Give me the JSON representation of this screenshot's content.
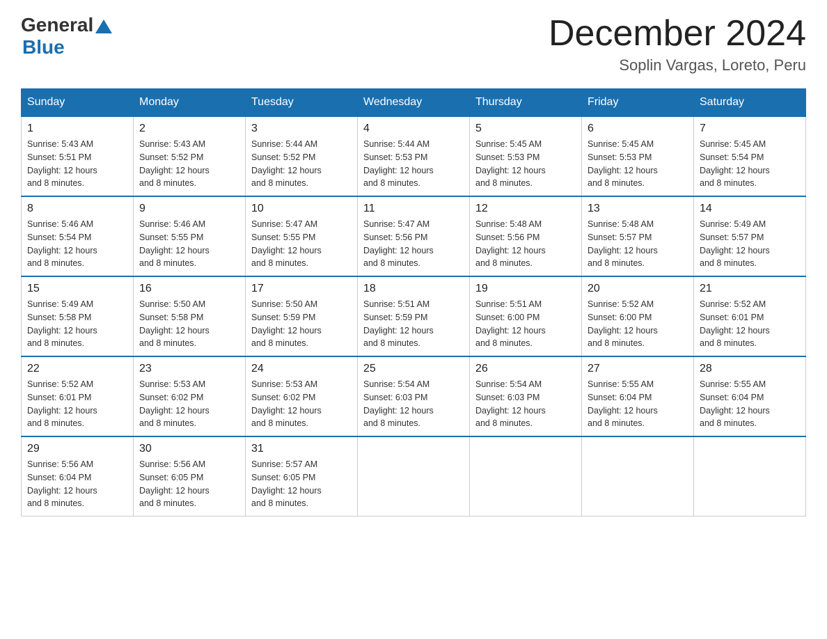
{
  "logo": {
    "general": "General",
    "blue": "Blue"
  },
  "title": {
    "month": "December 2024",
    "location": "Soplin Vargas, Loreto, Peru"
  },
  "headers": [
    "Sunday",
    "Monday",
    "Tuesday",
    "Wednesday",
    "Thursday",
    "Friday",
    "Saturday"
  ],
  "weeks": [
    [
      {
        "day": "1",
        "sunrise": "5:43 AM",
        "sunset": "5:51 PM",
        "daylight": "12 hours and 8 minutes."
      },
      {
        "day": "2",
        "sunrise": "5:43 AM",
        "sunset": "5:52 PM",
        "daylight": "12 hours and 8 minutes."
      },
      {
        "day": "3",
        "sunrise": "5:44 AM",
        "sunset": "5:52 PM",
        "daylight": "12 hours and 8 minutes."
      },
      {
        "day": "4",
        "sunrise": "5:44 AM",
        "sunset": "5:53 PM",
        "daylight": "12 hours and 8 minutes."
      },
      {
        "day": "5",
        "sunrise": "5:45 AM",
        "sunset": "5:53 PM",
        "daylight": "12 hours and 8 minutes."
      },
      {
        "day": "6",
        "sunrise": "5:45 AM",
        "sunset": "5:53 PM",
        "daylight": "12 hours and 8 minutes."
      },
      {
        "day": "7",
        "sunrise": "5:45 AM",
        "sunset": "5:54 PM",
        "daylight": "12 hours and 8 minutes."
      }
    ],
    [
      {
        "day": "8",
        "sunrise": "5:46 AM",
        "sunset": "5:54 PM",
        "daylight": "12 hours and 8 minutes."
      },
      {
        "day": "9",
        "sunrise": "5:46 AM",
        "sunset": "5:55 PM",
        "daylight": "12 hours and 8 minutes."
      },
      {
        "day": "10",
        "sunrise": "5:47 AM",
        "sunset": "5:55 PM",
        "daylight": "12 hours and 8 minutes."
      },
      {
        "day": "11",
        "sunrise": "5:47 AM",
        "sunset": "5:56 PM",
        "daylight": "12 hours and 8 minutes."
      },
      {
        "day": "12",
        "sunrise": "5:48 AM",
        "sunset": "5:56 PM",
        "daylight": "12 hours and 8 minutes."
      },
      {
        "day": "13",
        "sunrise": "5:48 AM",
        "sunset": "5:57 PM",
        "daylight": "12 hours and 8 minutes."
      },
      {
        "day": "14",
        "sunrise": "5:49 AM",
        "sunset": "5:57 PM",
        "daylight": "12 hours and 8 minutes."
      }
    ],
    [
      {
        "day": "15",
        "sunrise": "5:49 AM",
        "sunset": "5:58 PM",
        "daylight": "12 hours and 8 minutes."
      },
      {
        "day": "16",
        "sunrise": "5:50 AM",
        "sunset": "5:58 PM",
        "daylight": "12 hours and 8 minutes."
      },
      {
        "day": "17",
        "sunrise": "5:50 AM",
        "sunset": "5:59 PM",
        "daylight": "12 hours and 8 minutes."
      },
      {
        "day": "18",
        "sunrise": "5:51 AM",
        "sunset": "5:59 PM",
        "daylight": "12 hours and 8 minutes."
      },
      {
        "day": "19",
        "sunrise": "5:51 AM",
        "sunset": "6:00 PM",
        "daylight": "12 hours and 8 minutes."
      },
      {
        "day": "20",
        "sunrise": "5:52 AM",
        "sunset": "6:00 PM",
        "daylight": "12 hours and 8 minutes."
      },
      {
        "day": "21",
        "sunrise": "5:52 AM",
        "sunset": "6:01 PM",
        "daylight": "12 hours and 8 minutes."
      }
    ],
    [
      {
        "day": "22",
        "sunrise": "5:52 AM",
        "sunset": "6:01 PM",
        "daylight": "12 hours and 8 minutes."
      },
      {
        "day": "23",
        "sunrise": "5:53 AM",
        "sunset": "6:02 PM",
        "daylight": "12 hours and 8 minutes."
      },
      {
        "day": "24",
        "sunrise": "5:53 AM",
        "sunset": "6:02 PM",
        "daylight": "12 hours and 8 minutes."
      },
      {
        "day": "25",
        "sunrise": "5:54 AM",
        "sunset": "6:03 PM",
        "daylight": "12 hours and 8 minutes."
      },
      {
        "day": "26",
        "sunrise": "5:54 AM",
        "sunset": "6:03 PM",
        "daylight": "12 hours and 8 minutes."
      },
      {
        "day": "27",
        "sunrise": "5:55 AM",
        "sunset": "6:04 PM",
        "daylight": "12 hours and 8 minutes."
      },
      {
        "day": "28",
        "sunrise": "5:55 AM",
        "sunset": "6:04 PM",
        "daylight": "12 hours and 8 minutes."
      }
    ],
    [
      {
        "day": "29",
        "sunrise": "5:56 AM",
        "sunset": "6:04 PM",
        "daylight": "12 hours and 8 minutes."
      },
      {
        "day": "30",
        "sunrise": "5:56 AM",
        "sunset": "6:05 PM",
        "daylight": "12 hours and 8 minutes."
      },
      {
        "day": "31",
        "sunrise": "5:57 AM",
        "sunset": "6:05 PM",
        "daylight": "12 hours and 8 minutes."
      },
      null,
      null,
      null,
      null
    ]
  ],
  "labels": {
    "sunrise": "Sunrise:",
    "sunset": "Sunset:",
    "daylight": "Daylight:"
  }
}
